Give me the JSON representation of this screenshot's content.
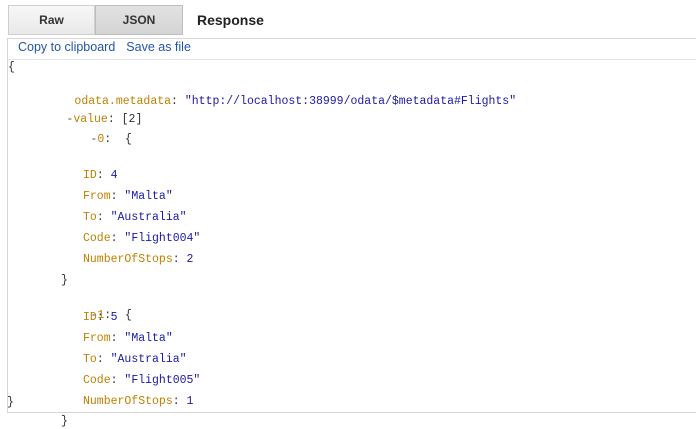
{
  "tabs": {
    "raw": "Raw",
    "json": "JSON"
  },
  "response_title": "Response",
  "actions": {
    "copy": "Copy to clipboard",
    "save": "Save as file"
  },
  "json_view": {
    "open_root": "{",
    "close_root": "}",
    "metadata": {
      "key": "odata.metadata",
      "value": "\"http://localhost:38999/odata/$metadata#Flights\""
    },
    "value": {
      "toggle": "-",
      "key": "value",
      "count": "[2]"
    },
    "items": [
      {
        "toggle": "-",
        "index": "0",
        "open": "{",
        "close": "}",
        "fields": [
          {
            "key": "ID",
            "value": "4"
          },
          {
            "key": "From",
            "value": "\"Malta\""
          },
          {
            "key": "To",
            "value": "\"Australia\""
          },
          {
            "key": "Code",
            "value": "\"Flight004\""
          },
          {
            "key": "NumberOfStops",
            "value": "2"
          }
        ]
      },
      {
        "toggle": "-",
        "index": "1",
        "open": "{",
        "close": "}",
        "fields": [
          {
            "key": "ID",
            "value": "5"
          },
          {
            "key": "From",
            "value": "\"Malta\""
          },
          {
            "key": "To",
            "value": "\"Australia\""
          },
          {
            "key": "Code",
            "value": "\"Flight005\""
          },
          {
            "key": "NumberOfStops",
            "value": "1"
          }
        ]
      }
    ]
  }
}
